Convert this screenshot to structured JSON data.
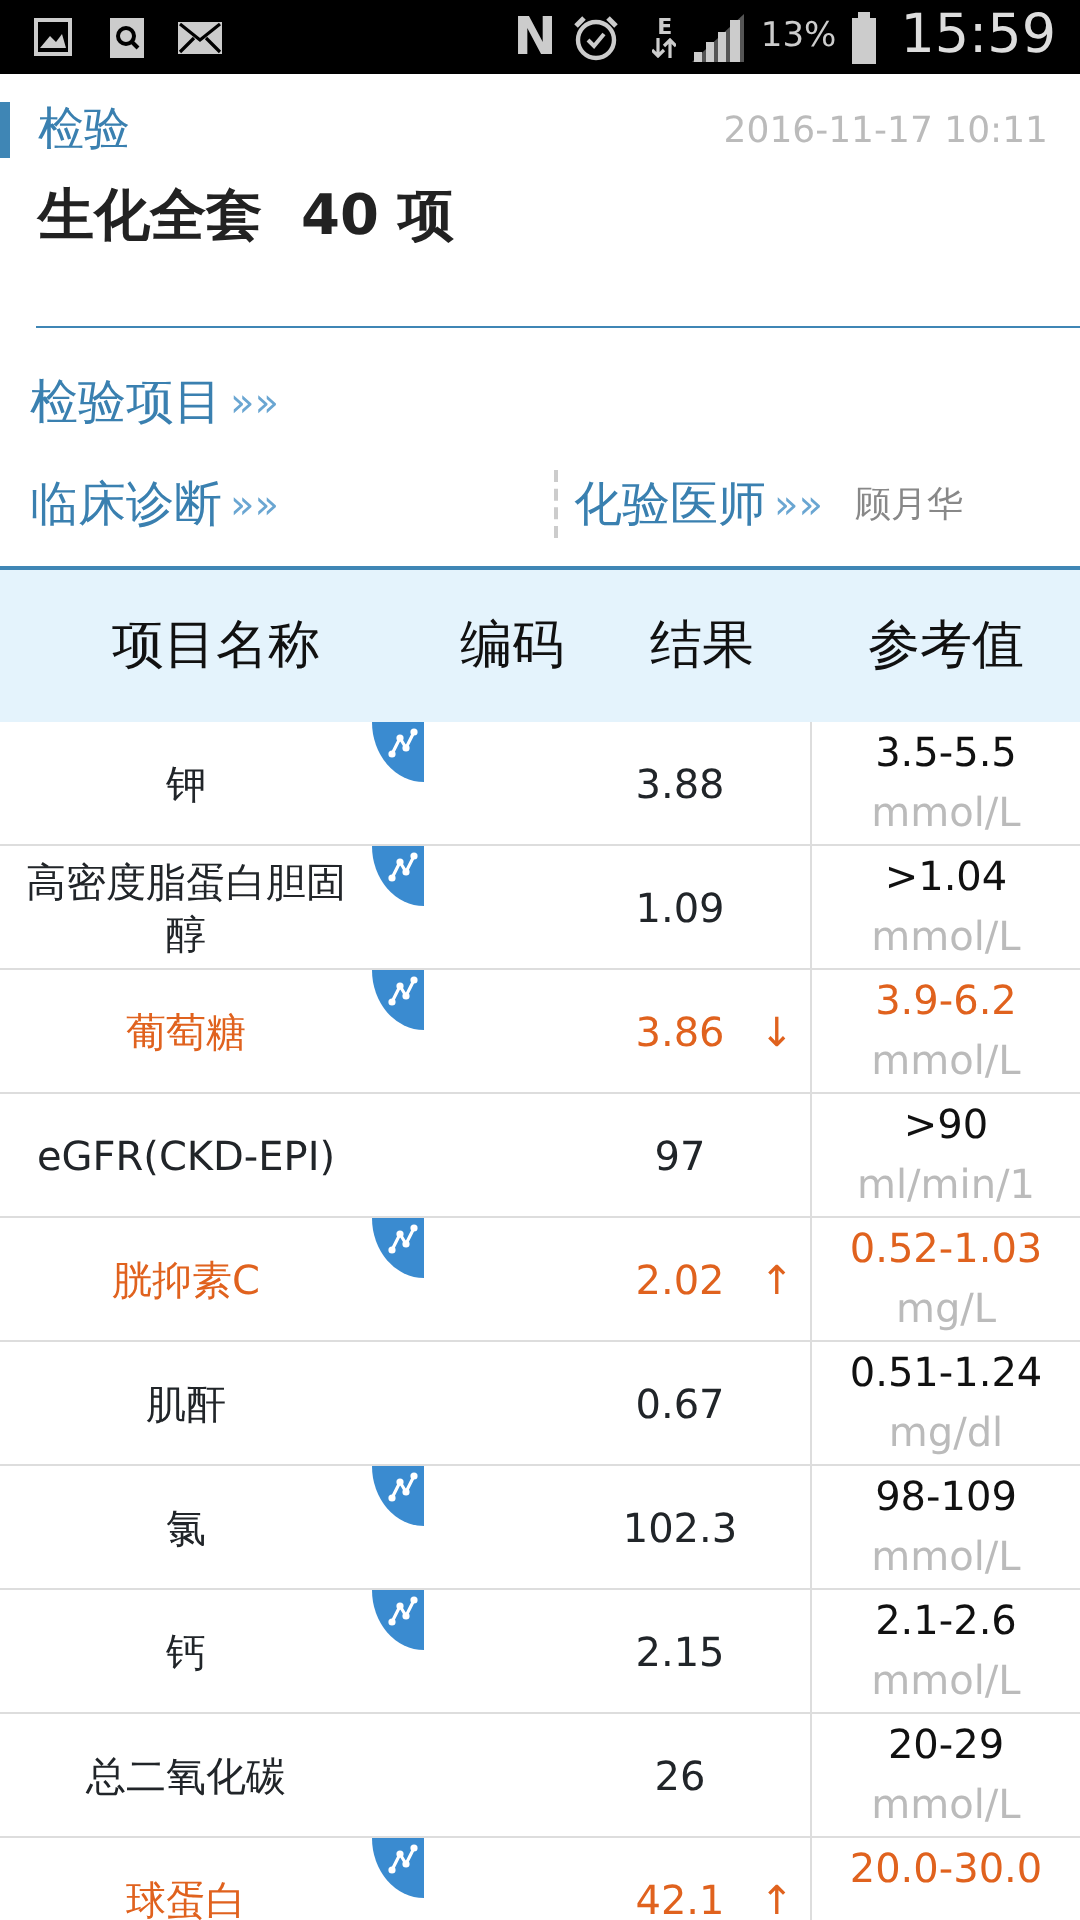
{
  "status_bar": {
    "nfc": "N",
    "network_type": "E",
    "battery": "13%",
    "time": "15:59"
  },
  "header": {
    "section": "检验",
    "date": "2016-11-17 10:11",
    "title": "生化全套  40 项"
  },
  "links": [
    {
      "label": "检验项目",
      "arrows": "»»"
    },
    {
      "label": "临床诊断",
      "arrows": "»»"
    },
    {
      "label": "化验医师",
      "arrows": "»»",
      "value": "顾月华"
    }
  ],
  "table": {
    "columns": [
      "项目名称",
      "编码",
      "结果",
      "参考值"
    ],
    "rows": [
      {
        "name": "钾",
        "result": "3.88",
        "range": "3.5-5.5",
        "unit": "mmol/L",
        "kind": "normal",
        "trend": true
      },
      {
        "name": "高密度脂蛋白胆固醇",
        "result": "1.09",
        "range": ">1.04",
        "unit": "mmol/L",
        "kind": "normal",
        "trend": true
      },
      {
        "name": "葡萄糖",
        "result": "3.86",
        "arrow": "↓",
        "range": "3.9-6.2",
        "unit": "mmol/L",
        "kind": "low",
        "trend": true
      },
      {
        "name": "eGFR(CKD-EPI)",
        "result": "97",
        "range": ">90",
        "unit": "ml/min/1",
        "kind": "normal",
        "trend": false
      },
      {
        "name": "胱抑素C",
        "result": "2.02",
        "arrow": "↑",
        "range": "0.52-1.03",
        "unit": "mg/L",
        "kind": "high",
        "trend": true
      },
      {
        "name": "肌酐",
        "result": "0.67",
        "range": "0.51-1.24",
        "unit": "mg/dl",
        "kind": "normal",
        "trend": false
      },
      {
        "name": "氯",
        "result": "102.3",
        "range": "98-109",
        "unit": "mmol/L",
        "kind": "normal",
        "trend": true
      },
      {
        "name": "钙",
        "result": "2.15",
        "range": "2.1-2.6",
        "unit": "mmol/L",
        "kind": "normal",
        "trend": true
      },
      {
        "name": "总二氧化碳",
        "result": "26",
        "range": "20-29",
        "unit": "mmol/L",
        "kind": "normal",
        "trend": false
      },
      {
        "name": "球蛋白",
        "result": "42.1",
        "arrow": "↑",
        "range": "20.0-30.0",
        "kind": "high",
        "trend": true
      }
    ]
  }
}
